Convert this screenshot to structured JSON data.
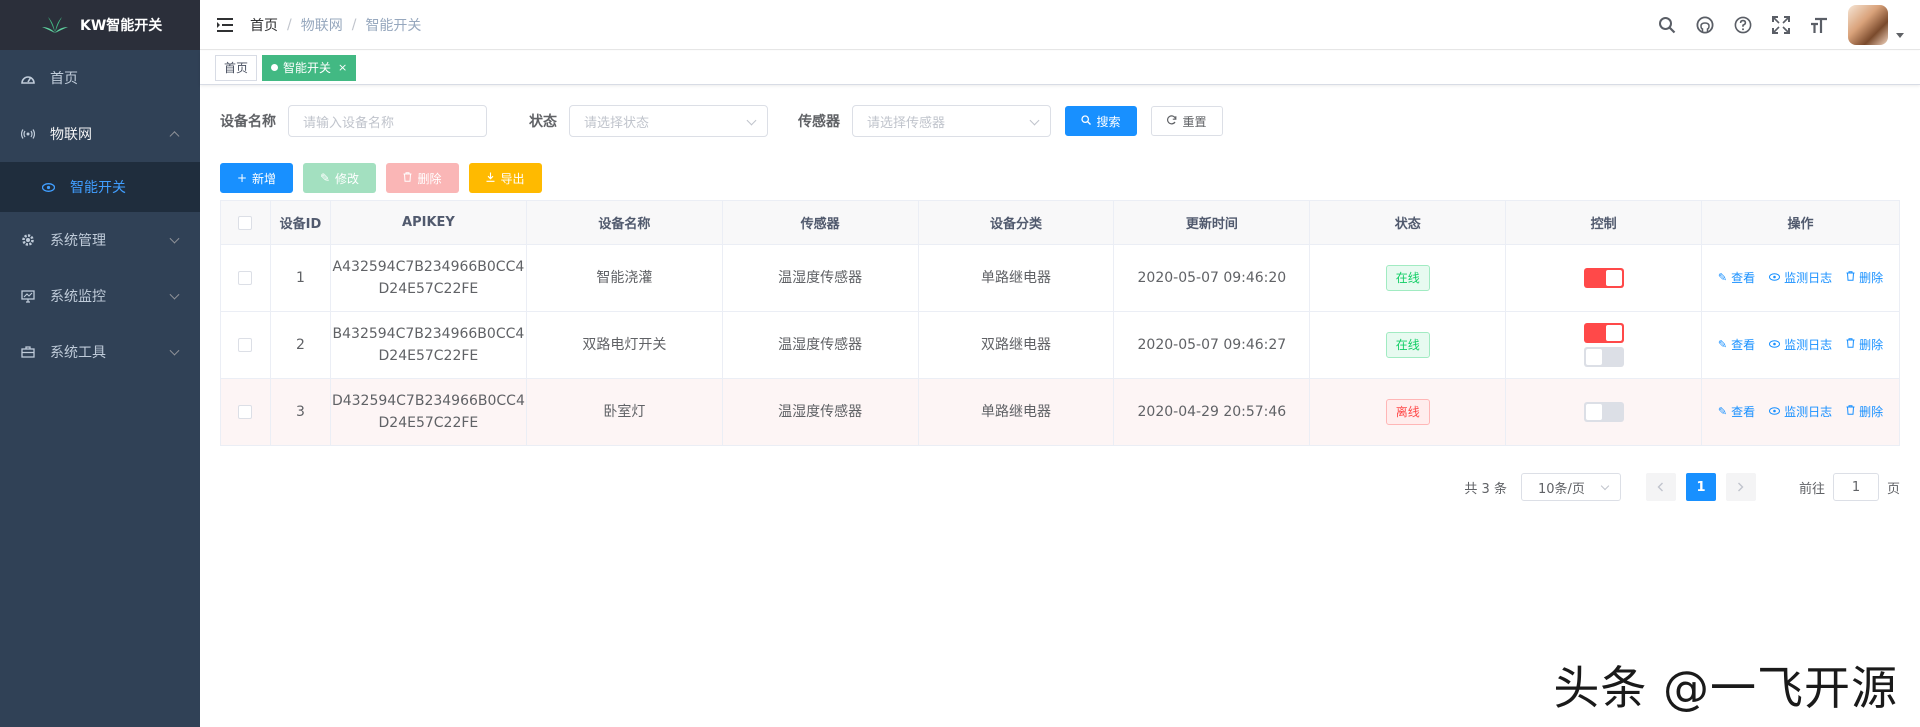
{
  "app": {
    "title": "KW智能开关"
  },
  "sidebar": {
    "items": [
      {
        "label": "首页",
        "icon": "dashboard-icon"
      },
      {
        "label": "物联网",
        "icon": "iot-signal-icon",
        "expanded": true,
        "children": [
          {
            "label": "智能开关",
            "icon": "eye-icon",
            "active": true
          }
        ]
      },
      {
        "label": "系统管理",
        "icon": "gear-icon"
      },
      {
        "label": "系统监控",
        "icon": "monitor-icon"
      },
      {
        "label": "系统工具",
        "icon": "toolbox-icon"
      }
    ]
  },
  "header": {
    "breadcrumb": [
      "首页",
      "物联网",
      "智能开关"
    ],
    "separator": "/",
    "tools": [
      "search-icon",
      "github-icon",
      "help-icon",
      "fullscreen-icon",
      "font-size-icon"
    ]
  },
  "tags": [
    {
      "label": "首页",
      "active": false
    },
    {
      "label": "智能开关",
      "active": true,
      "close": "×"
    }
  ],
  "search": {
    "device_name_label": "设备名称",
    "device_name_placeholder": "请输入设备名称",
    "status_label": "状态",
    "status_placeholder": "请选择状态",
    "sensor_label": "传感器",
    "sensor_placeholder": "请选择传感器",
    "search_btn": "搜索",
    "reset_btn": "重置"
  },
  "toolbar": {
    "add": "新增",
    "edit": "修改",
    "delete": "删除",
    "export": "导出"
  },
  "table": {
    "columns": [
      "设备ID",
      "APIKEY",
      "设备名称",
      "传感器",
      "设备分类",
      "更新时间",
      "状态",
      "控制",
      "操作"
    ],
    "rows": [
      {
        "id": "1",
        "apikey_1": "A432594C7B234966B0CC4",
        "apikey_2": "D24E57C22FE",
        "name": "智能浇灌",
        "sensor": "温湿度传感器",
        "category": "单路继电器",
        "updated": "2020-05-07 09:46:20",
        "status": "在线",
        "online": true,
        "switches": [
          true
        ]
      },
      {
        "id": "2",
        "apikey_1": "B432594C7B234966B0CC4",
        "apikey_2": "D24E57C22FE",
        "name": "双路电灯开关",
        "sensor": "温湿度传感器",
        "category": "双路继电器",
        "updated": "2020-05-07 09:46:27",
        "status": "在线",
        "online": true,
        "switches": [
          true,
          false
        ]
      },
      {
        "id": "3",
        "apikey_1": "D432594C7B234966B0CC4",
        "apikey_2": "D24E57C22FE",
        "name": "卧室灯",
        "sensor": "温湿度传感器",
        "category": "单路继电器",
        "updated": "2020-04-29 20:57:46",
        "status": "离线",
        "online": false,
        "switches": [
          false
        ]
      }
    ],
    "ops": {
      "view": "查看",
      "log": "监测日志",
      "delete": "删除"
    }
  },
  "pagination": {
    "total": "共 3 条",
    "page_size": "10条/页",
    "current": "1",
    "goto_label": "前往",
    "goto_value": "1",
    "page_suffix": "页"
  },
  "watermark": "头条 @一飞开源",
  "colors": {
    "sidebar": "#304156",
    "primary": "#1890ff",
    "tag_active": "#42b983",
    "switch_on": "#ff4949"
  }
}
